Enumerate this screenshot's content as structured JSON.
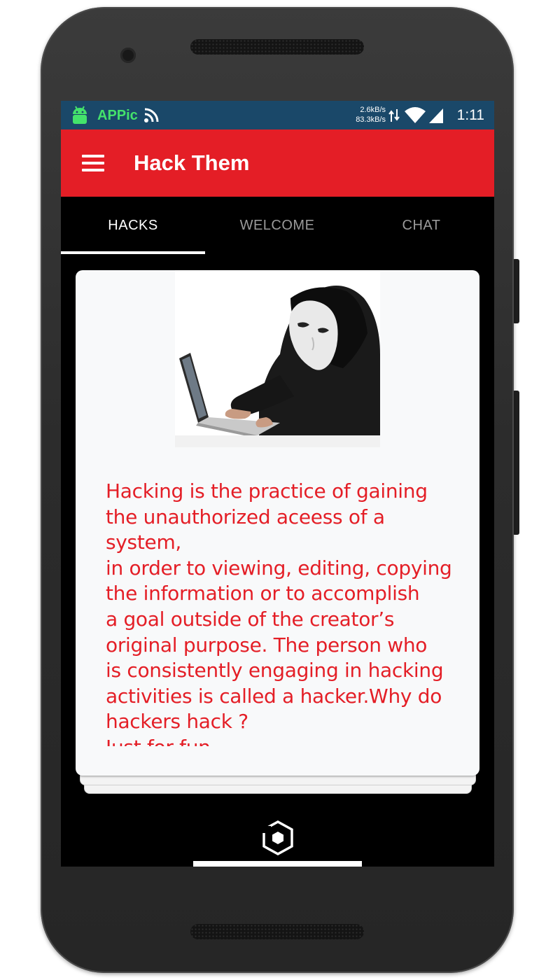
{
  "status_bar": {
    "app_name": "APPic",
    "app_icon": "android-icon",
    "feed_icon": "rss-icon",
    "net_up": "2.6kB/s",
    "net_down": "83.3kB/s",
    "data_icon": "data-transfer-icon",
    "wifi_icon": "wifi-icon",
    "signal_icon": "cell-signal-icon",
    "time": "1:11"
  },
  "app_bar": {
    "menu_icon": "hamburger-menu-icon",
    "title": "Hack Them"
  },
  "tabs": [
    {
      "label": "HACKS",
      "active": true
    },
    {
      "label": "WELCOME",
      "active": false
    },
    {
      "label": "CHAT",
      "active": false
    }
  ],
  "card": {
    "image": "masked-hacker-at-laptop",
    "text": "Hacking is the practice of gaining\nthe unauthorized aceess of a system,\nin order to viewing, editing, copying\nthe information or to accomplish\na goal outside of the creator’s\noriginal purpose. The person who\nis consistently engaging in hacking\nactivities is called a hacker.Why do\nhackers hack ?\nJust for fun\nTo show off"
  },
  "fab": {
    "icon": "hexagon-logo-icon"
  },
  "colors": {
    "accent": "#e41e26",
    "status_bar": "#1a4869",
    "app_name": "#44e26b",
    "card_bg": "#f8f9fa",
    "screen_bg": "#000000"
  }
}
